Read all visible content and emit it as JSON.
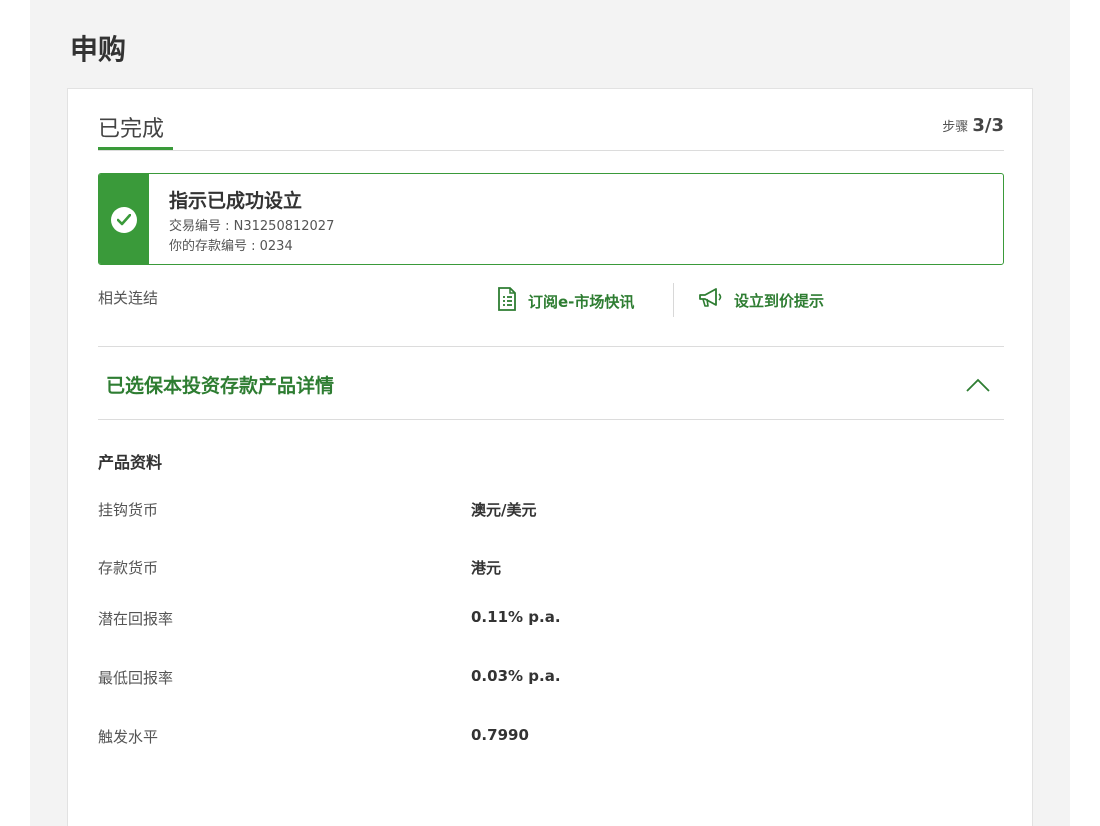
{
  "page": {
    "title": "申购"
  },
  "step": {
    "title": "已完成",
    "indicator_prefix": "步骤",
    "indicator_value": "3/3"
  },
  "success": {
    "title": "指示已成功设立",
    "transaction_line": "交易编号 : N31250812027",
    "deposit_line": "你的存款编号 : 0234"
  },
  "related": {
    "label": "相关连结",
    "links": [
      {
        "label": "订阅e-市场快讯",
        "icon": "document-icon"
      },
      {
        "label": "设立到价提示",
        "icon": "megaphone-icon"
      }
    ]
  },
  "section": {
    "title": "已选保本投资存款产品详情"
  },
  "product": {
    "title": "产品资料",
    "rows": [
      {
        "label": "挂钩货币",
        "value": "澳元/美元"
      },
      {
        "label": "存款货币",
        "value": "港元"
      },
      {
        "label": "潜在回报率",
        "value": "0.11% p.a."
      },
      {
        "label": "最低回报率",
        "value": "0.03% p.a."
      },
      {
        "label": "触发水平",
        "value": "0.7990"
      }
    ]
  },
  "colors": {
    "accent": "#3a9a3a",
    "link": "#2e7d32"
  }
}
